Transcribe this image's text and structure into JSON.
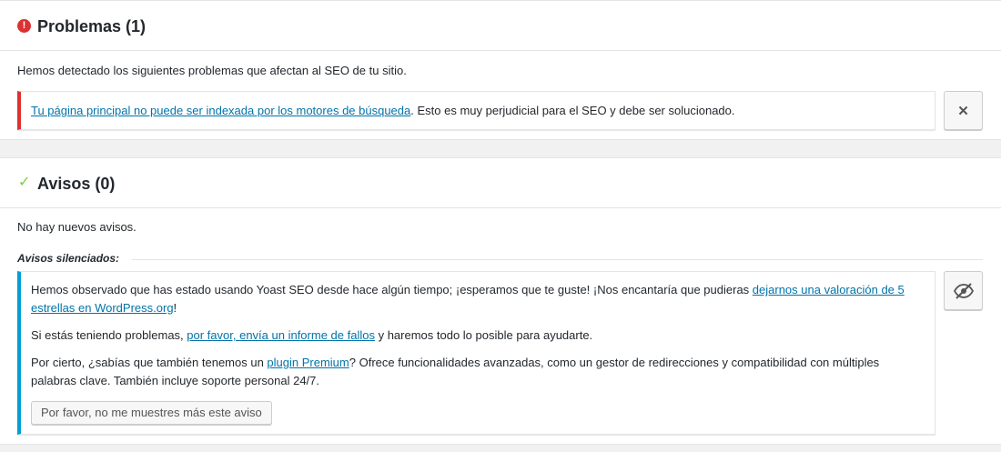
{
  "problems": {
    "title": "Problemas (1)",
    "intro": "Hemos detectado los siguientes problemas que afectan al SEO de tu sitio.",
    "notice": {
      "link_text": "Tu página principal no puede ser indexada por los motores de búsqueda",
      "text": ". Esto es muy perjudicial para el SEO y debe ser solucionado."
    },
    "icon": "alert-circle-icon",
    "icon_glyph": "!",
    "close_glyph": "✕"
  },
  "warnings": {
    "title": "Avisos (0)",
    "intro": "No hay nuevos avisos.",
    "muted_heading": "Avisos silenciados:",
    "icon": "checkmark-icon",
    "icon_glyph": "✓",
    "notice": {
      "p1_before": "Hemos observado que has estado usando Yoast SEO desde hace algún tiempo; ¡esperamos que te guste! ¡Nos encantaría que pudieras ",
      "p1_link": "dejarnos una valoración de 5 estrellas en WordPress.org",
      "p1_after": "!",
      "p2_before": "Si estás teniendo problemas, ",
      "p2_link": "por favor, envía un informe de fallos",
      "p2_after": " y haremos todo lo posible para ayudarte.",
      "p3_before": "Por cierto, ¿sabías que también tenemos un ",
      "p3_link": "plugin Premium",
      "p3_after": "? Ofrece funcionalidades avanzadas, como un gestor de redirecciones y compatibilidad con múltiples palabras clave. También incluye soporte personal 24/7.",
      "dismiss_label": "Por favor, no me muestres más este aviso"
    }
  },
  "colors": {
    "error": "#dc3232",
    "success": "#7ad03a",
    "info": "#00a0d2",
    "link": "#0073aa"
  }
}
